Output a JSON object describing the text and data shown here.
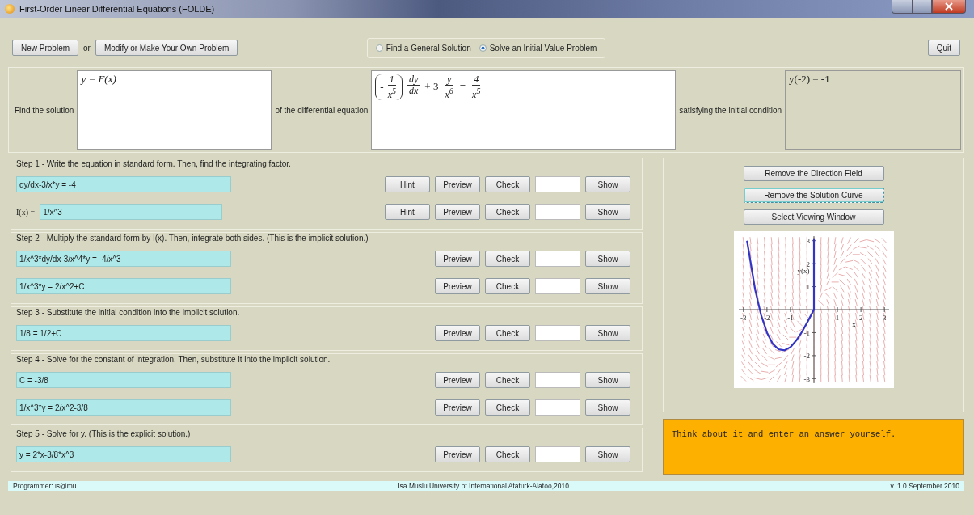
{
  "window": {
    "title": "First-Order Linear Differential Equations (FOLDE)"
  },
  "toolbar": {
    "new_button": "New Problem",
    "separator": "or",
    "modify_button": "Modify or Make Your Own Problem",
    "modes": [
      {
        "label": "Find a General Solution",
        "selected": false
      },
      {
        "label": "Solve an Initial Value Problem",
        "selected": true
      }
    ],
    "quit_button": "Quit"
  },
  "problem": {
    "solution_label": "Find the solution",
    "solution": "y = F(x)",
    "equation_label": "of the differential equation",
    "equation": [
      {
        "kind": "paren",
        "sign": "-",
        "num": "1",
        "den": "x$^{5}$"
      },
      {
        "kind": "frac",
        "num": "dy",
        "den": "dx"
      },
      {
        "kind": "text",
        "text": "+ 3"
      },
      {
        "kind": "frac",
        "num": "y",
        "den": "x$^{6}$"
      },
      {
        "kind": "text",
        "text": "="
      },
      {
        "kind": "frac",
        "num": "4",
        "den": "x$^{5}$"
      }
    ],
    "condition_label": "satisfying the initial condition",
    "condition": "y(-2) = -1"
  },
  "steps": [
    {
      "title": "Step 1 - Write the equation in standard form. Then, find the integrating factor.",
      "rows": [
        {
          "value": "dy/dx-3/x*y = -4",
          "buttons": [
            "Hint",
            "Preview",
            "Check"
          ],
          "show_button": "Show"
        },
        {
          "label": "I(x) =",
          "value": "1/x^3",
          "buttons": [
            "Hint",
            "Preview",
            "Check"
          ],
          "show_button": "Show"
        }
      ]
    },
    {
      "title": "Step 2 - Multiply the standard form by I(x). Then, integrate both sides. (This is the implicit solution.)",
      "rows": [
        {
          "value": "1/x^3*dy/dx-3/x^4*y = -4/x^3",
          "buttons": [
            "Preview",
            "Check"
          ],
          "show_button": "Show"
        },
        {
          "value": "1/x^3*y = 2/x^2+C",
          "buttons": [
            "Preview",
            "Check"
          ],
          "show_button": "Show"
        }
      ]
    },
    {
      "title": "Step 3 - Substitute the initial condition into the implicit solution.",
      "rows": [
        {
          "value": "1/8 = 1/2+C",
          "buttons": [
            "Preview",
            "Check"
          ],
          "show_button": "Show"
        }
      ]
    },
    {
      "title": "Step 4 - Solve for the constant of integration. Then, substitute it into the implicit solution.",
      "rows": [
        {
          "value": "C = -3/8",
          "buttons": [
            "Preview",
            "Check"
          ],
          "show_button": "Show"
        },
        {
          "value": "1/x^3*y = 2/x^2-3/8",
          "buttons": [
            "Preview",
            "Check"
          ],
          "show_button": "Show"
        }
      ]
    },
    {
      "title": "Step 5 - Solve for y. (This is the explicit solution.)",
      "rows": [
        {
          "value": "y = 2*x-3/8*x^3",
          "buttons": [
            "Preview",
            "Check"
          ],
          "show_button": "Show"
        }
      ]
    }
  ],
  "graph_panel": {
    "buttons": [
      {
        "label": "Remove the Direction Field",
        "focused": false
      },
      {
        "label": "Remove the Solution Curve",
        "focused": true
      },
      {
        "label": "Select Viewing Window",
        "focused": false
      }
    ],
    "chart_data": {
      "type": "line",
      "xlabel": "x",
      "ylabel": "y(x)",
      "x": [
        -2.85,
        -2.5,
        -2.25,
        -2,
        -1.75,
        -1.5,
        -1.25,
        -1,
        -0.75,
        -0.5,
        -0.25,
        0,
        0
      ],
      "series": [
        {
          "color": "#3434c4",
          "values": [
            3,
            0.86,
            -0.23,
            -1,
            -1.49,
            -1.73,
            -1.77,
            -1.63,
            -1.34,
            -0.95,
            -0.49,
            0,
            3.1
          ]
        }
      ],
      "xlim": [
        -3.2,
        3.2
      ],
      "ylim": [
        -3.2,
        3.2
      ],
      "xticks": [
        -3,
        -2,
        -1,
        1,
        2,
        3
      ],
      "yticks": [
        -3,
        -2,
        -1,
        1,
        2,
        3
      ]
    }
  },
  "message": "Think about it and enter an answer yourself.",
  "status_bar": {
    "programmer": "Programmer: is@mu",
    "credit": "Isa Muslu,University of International Ataturk-Alatoo,2010",
    "version": "v. 1.0 September 2010"
  }
}
